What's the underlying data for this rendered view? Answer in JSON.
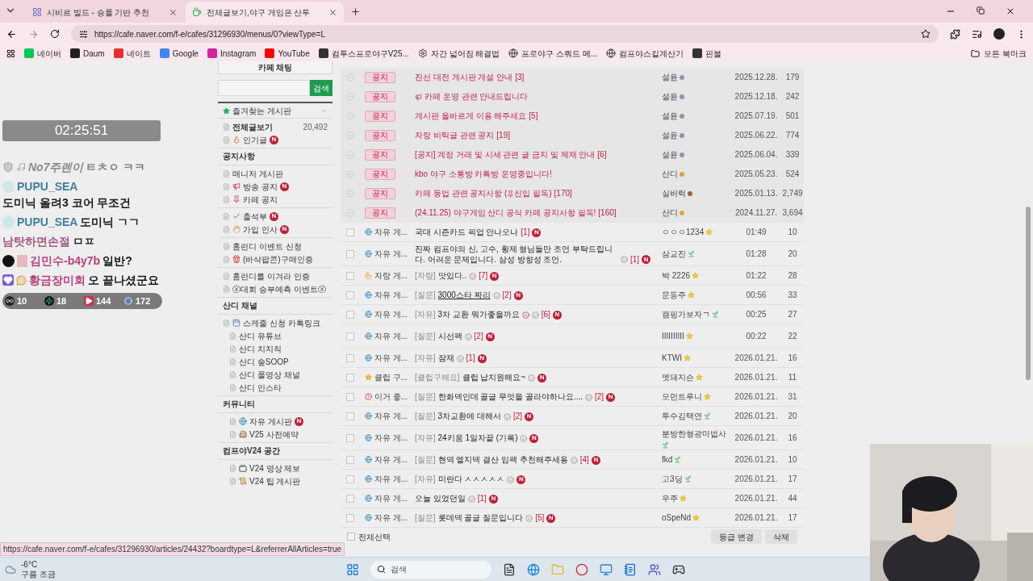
{
  "browser": {
    "tabs": [
      {
        "title": "시비르 빌드 - 승률 기반 추천",
        "kind": "app",
        "selected": false
      },
      {
        "title": "전체글보기,야구 게임은 산투",
        "kind": "cafe",
        "selected": true
      }
    ],
    "url": "https://cafe.naver.com/f-e/cafes/31296930/menus/0?viewType=L",
    "bookmarks": [
      {
        "label": "네이버",
        "kind": "naver"
      },
      {
        "label": "Daum",
        "kind": "daum"
      },
      {
        "label": "네이트",
        "kind": "nate"
      },
      {
        "label": "Google",
        "kind": "google"
      },
      {
        "label": "Instagram",
        "kind": "instagram"
      },
      {
        "label": "YouTube",
        "kind": "youtube"
      },
      {
        "label": "컴투스프로야구V25..."
      },
      {
        "label": "자간 넓어짐 해결법",
        "kind": "gear"
      },
      {
        "label": "프로야구 스쿼드 메...",
        "kind": "globe"
      },
      {
        "label": "컴프야스킬계산기",
        "kind": "globe"
      },
      {
        "label": "핀볼"
      }
    ],
    "all_bookmarks": "모든 북마크"
  },
  "stream": {
    "timer": "02:25:51",
    "chat": [
      {
        "badges": [
          {
            "kind": "shield"
          },
          {
            "kind": "note"
          }
        ],
        "nick": "No7주렌이",
        "text": "ㅌㅊㅇ ㅋㅋ",
        "color": "#8a8a8a",
        "faded": true
      },
      {
        "badges": [
          {
            "kind": "half"
          }
        ],
        "nick": "PUPU_SEA",
        "text": "도미닉 올려3 코어 무조건",
        "color": "#3f7fa0",
        "faded": false
      },
      {
        "badges": [
          {
            "kind": "half"
          }
        ],
        "nick": "PUPU_SEA",
        "text": "도미닉 ㄱㄱ",
        "color": "#3f7fa0",
        "faded": false
      },
      {
        "nick": "남탓하면손절",
        "text": "ㅁㅍ",
        "color": "#a05a80",
        "faded": false
      },
      {
        "badges": [
          {
            "kind": "dot"
          },
          {
            "kind": "box"
          }
        ],
        "nick": "김민수-b4y7b",
        "text": "일반?",
        "color": "#b8407a",
        "faded": false
      },
      {
        "badges": [
          {
            "kind": "heart"
          },
          {
            "kind": "bubble"
          }
        ],
        "nick": "황금장미회",
        "text": "오 끝나셨군요",
        "color": "#b8407a",
        "faded": false
      }
    ],
    "stats": [
      {
        "kind": "infinity",
        "count": "10"
      },
      {
        "kind": "bolt",
        "count": "18"
      },
      {
        "kind": "play",
        "count": "144"
      },
      {
        "kind": "circle",
        "count": "172"
      }
    ]
  },
  "sidebar": {
    "chat_button": "카페 채팅",
    "search_button": "검색",
    "favorites": "즐겨찾는 게시판",
    "sections": [
      {
        "items": [
          {
            "label": "전체글보기",
            "count": "20,492",
            "bold": true,
            "kind": "plain"
          },
          {
            "label": "인기글",
            "badge": "N",
            "bold": false,
            "kind": "flame"
          }
        ]
      },
      {
        "title": "공지사항",
        "items": [
          {
            "label": "매니저 게시판",
            "bold": false,
            "kind": "plain"
          },
          {
            "label": "방송 공지",
            "badge": "N",
            "bold": false,
            "kind": "megaphone"
          },
          {
            "label": "카페 공지",
            "bold": false,
            "kind": "pin"
          }
        ]
      },
      {
        "items": [
          {
            "label": "출석부",
            "badge": "N",
            "bold": false,
            "kind": "check"
          },
          {
            "label": "가입 인사",
            "badge": "N",
            "bold": false,
            "kind": "hand"
          }
        ]
      },
      {
        "items": [
          {
            "label": "홈런디 이벤트 신청",
            "bold": false,
            "kind": "plain"
          },
          {
            "label": "(바삭팝콘)구매인증",
            "bold": false,
            "kind": "popcorn"
          }
        ]
      },
      {
        "items": [
          {
            "label": "홈런디를 이겨라 인증",
            "bold": false,
            "kind": "plain"
          },
          {
            "label": "ⓧ대회 승부예측 이벤트ⓧ",
            "bold": false,
            "kind": "plain"
          }
        ]
      },
      {
        "title": "산디 채널",
        "items": [
          {
            "label": "스케줄 신청 카톡링크",
            "bold": false,
            "kind": "calendar"
          }
        ],
        "subitems": [
          {
            "label": "산디 유튜브",
            "kind": "plain"
          },
          {
            "label": "산디 치지직",
            "kind": "plain"
          },
          {
            "label": "산디 숲SOOP",
            "kind": "plain"
          },
          {
            "label": "산디 풀영상 채널",
            "kind": "plain"
          },
          {
            "label": "산디 인스타",
            "kind": "plain"
          }
        ]
      },
      {
        "title": "커뮤니티",
        "subitems": [
          {
            "label": "자유 게시판",
            "badge": "N",
            "kind": "globe"
          },
          {
            "label": "V25 사전예약",
            "kind": "building"
          }
        ]
      },
      {
        "title": "컴프야V24 공간",
        "subitems": [
          {
            "label": "V24 영상 제보",
            "kind": "tv"
          },
          {
            "label": "V24 팁 게시판",
            "kind": "scroll"
          }
        ]
      }
    ]
  },
  "board": {
    "rows": [
      {
        "kind": "notice",
        "tag": "공지",
        "title": "진선 대전 게시판 개설 안내",
        "comments": "[3]",
        "author": "설윤",
        "rank": {
          "kind": "dot",
          "color": "#8a96b0"
        },
        "date": "2025.12.28.",
        "views": "179"
      },
      {
        "kind": "notice",
        "tag": "공지",
        "lead": {
          "kind": "megaphone"
        },
        "title": "카페 운영 관련 안내드립니다",
        "author": "설윤",
        "rank": {
          "kind": "dot",
          "color": "#8a96b0"
        },
        "date": "2025.12.18.",
        "views": "242"
      },
      {
        "kind": "notice",
        "tag": "공지",
        "title": "게시판 올바르게 이용 해주세요",
        "comments": "[5]",
        "author": "설윤",
        "rank": {
          "kind": "dot",
          "color": "#8a96b0"
        },
        "date": "2025.07.19.",
        "views": "501"
      },
      {
        "kind": "notice",
        "tag": "공지",
        "title": "자랑 비틱글 관련 공지",
        "comments": "[19]",
        "author": "설윤",
        "rank": {
          "kind": "dot",
          "color": "#8a96b0"
        },
        "date": "2025.06.22.",
        "views": "774"
      },
      {
        "kind": "notice",
        "tag": "공지",
        "title": "[공지] 계정 거래 및 시세 관련 글 금지 및 제재 안내",
        "comments": "[6]",
        "author": "설윤",
        "rank": {
          "kind": "dot",
          "color": "#8a96b0"
        },
        "date": "2025.06.04.",
        "views": "339"
      },
      {
        "kind": "notice",
        "tag": "공지",
        "title": "kbo 야구 소통방 카톡방 운영중입니다!",
        "author": "산디",
        "rank": {
          "kind": "dot",
          "color": "#e0a63a"
        },
        "date": "2025.05.23.",
        "views": "524"
      },
      {
        "kind": "notice",
        "tag": "공지",
        "title": "카페 등업 관련 공지사항 (",
        "inline": {
          "kind": "pin"
        },
        "title_rest": "신입 필독)",
        "comments": "[170]",
        "author": "실버럭",
        "rank": {
          "kind": "dot",
          "color": "#a0603a"
        },
        "date": "2025.01.13.",
        "views": "2,749"
      },
      {
        "kind": "notice",
        "tag": "공지",
        "title": "(24.11.25) 야구게임 산디 공식 카페 공지사항 필독!",
        "comments": "[160]",
        "author": "산디",
        "rank": {
          "kind": "dot",
          "color": "#e0a63a"
        },
        "date": "2024.11.27.",
        "views": "3,694"
      },
      {
        "kind": "post",
        "checked": false,
        "board": {
          "label": "자유 게...",
          "kind": "globe"
        },
        "title": "국대 시즌카드 픽업 안나오나",
        "comments": "[1]",
        "badge": "N",
        "author": "ㅇㅇㅇ1234",
        "rank": {
          "kind": "star"
        },
        "date": "01:49",
        "views": "10"
      },
      {
        "kind": "post",
        "checked": false,
        "board": {
          "label": "자유 게...",
          "kind": "globe"
        },
        "title": "진짜 컴프야의 신, 고수, 황제 형님들만 조언 부탁드립니다. 어려운 문제입니다. 삼성 방향성 조언.",
        "image": true,
        "comments": "[1]",
        "badge": "N",
        "author": "삼교진",
        "rank": {
          "kind": "sprout"
        },
        "date": "01:28",
        "views": "20"
      },
      {
        "kind": "post",
        "checked": false,
        "board": {
          "label": "자랑 게...",
          "kind": "arm"
        },
        "prefix": "[자랑]",
        "title": "맛있다..",
        "image": true,
        "comments": "[7]",
        "badge": "N",
        "author": "박 2226",
        "rank": {
          "kind": "star"
        },
        "date": "01:22",
        "views": "28"
      },
      {
        "kind": "post",
        "checked": false,
        "board": {
          "label": "자유 게...",
          "kind": "globe"
        },
        "prefix": "[질문]",
        "title": "3000스타 짜리",
        "hovered": true,
        "image": true,
        "comments": "[2]",
        "badge": "N",
        "author": "문동주",
        "rank": {
          "kind": "star"
        },
        "date": "00:56",
        "views": "33"
      },
      {
        "kind": "post",
        "checked": false,
        "board": {
          "label": "자유 게...",
          "kind": "globe"
        },
        "prefix": "[자유]",
        "title": "3차 교환 뭐가좋을까요",
        "crying": true,
        "image": true,
        "comments": "[6]",
        "badge": "N",
        "author": "캠핑가보자ㄱ",
        "rank": {
          "kind": "sprout"
        },
        "date": "00:25",
        "views": "27"
      },
      {
        "kind": "post",
        "checked": false,
        "board": {
          "label": "자유 게...",
          "kind": "globe"
        },
        "prefix": "[질문]",
        "title": "시선팩",
        "image": true,
        "comments": "[2]",
        "badge": "N",
        "author": "IIIIIIIIII",
        "rank": {
          "kind": "star"
        },
        "date": "00:22",
        "views": "22"
      },
      {
        "kind": "post",
        "checked": false,
        "board": {
          "label": "자유 게...",
          "kind": "globe"
        },
        "prefix": "[자유]",
        "title": "잠재",
        "image": true,
        "comments": "[1]",
        "badge": "N",
        "author": "KTWI",
        "rank": {
          "kind": "star"
        },
        "date": "2026.01.21.",
        "views": "16"
      },
      {
        "kind": "post",
        "checked": false,
        "board": {
          "label": "클럽 구...",
          "kind": "star"
        },
        "prefix": "[클럽구해요]",
        "title": "클럽 납치원해요~",
        "image": true,
        "badge": "N",
        "author": "멧돼지슨",
        "rank": {
          "kind": "star"
        },
        "date": "2026.01.21.",
        "views": "11"
      },
      {
        "kind": "post",
        "checked": false,
        "board": {
          "label": "이거 좋...",
          "kind": "question"
        },
        "prefix": "[질문]",
        "title": "한화덱인데 골글 무엇을 골라야하나요....",
        "image": true,
        "comments": "[2]",
        "badge": "N",
        "author": "모먼트루니",
        "rank": {
          "kind": "star"
        },
        "date": "2026.01.21.",
        "views": "31"
      },
      {
        "kind": "post",
        "checked": false,
        "board": {
          "label": "자유 게...",
          "kind": "globe"
        },
        "prefix": "[질문]",
        "title": "3차교환에 대해서",
        "image": true,
        "comments": "[2]",
        "badge": "N",
        "author": "투수김택연",
        "rank": {
          "kind": "sprout"
        },
        "date": "2026.01.21.",
        "views": "20"
      },
      {
        "kind": "post",
        "checked": false,
        "board": {
          "label": "자유 게...",
          "kind": "globe"
        },
        "prefix": "[자유]",
        "title": "24키움 1일차끝 (기록)",
        "image": true,
        "badge": "N",
        "author": "분방한형광마법사",
        "rank": {
          "kind": "sprout"
        },
        "date": "2026.01.21.",
        "views": "16"
      },
      {
        "kind": "post",
        "checked": false,
        "board": {
          "label": "자유 게...",
          "kind": "globe"
        },
        "prefix": "[질문]",
        "title": "현역 엘지덱 결산 임팩 추천해주세용",
        "image": true,
        "comments": "[4]",
        "badge": "N",
        "author": "fkd",
        "rank": {
          "kind": "sprout"
        },
        "date": "2026.01.21.",
        "views": "10"
      },
      {
        "kind": "post",
        "checked": false,
        "board": {
          "label": "자유 게...",
          "kind": "globe"
        },
        "prefix": "[자유]",
        "title": "미란다 ㅅㅅㅅㅅㅅ",
        "image": true,
        "badge": "N",
        "author": "고3딩",
        "rank": {
          "kind": "sprout"
        },
        "date": "2026.01.21.",
        "views": "17"
      },
      {
        "kind": "post",
        "checked": false,
        "board": {
          "label": "자유 게...",
          "kind": "globe"
        },
        "title": "오늘 있었던일",
        "image": true,
        "comments": "[1]",
        "badge": "N",
        "author": "우주",
        "rank": {
          "kind": "star"
        },
        "date": "2026.01.21.",
        "views": "44"
      },
      {
        "kind": "post",
        "checked": false,
        "board": {
          "label": "자유 게...",
          "kind": "globe"
        },
        "prefix": "[질문]",
        "title": "롯데덱 골글 질문입니다",
        "image": true,
        "comments": "[5]",
        "badge": "N",
        "author": "oSpeNd",
        "rank": {
          "kind": "star"
        },
        "date": "2026.01.21.",
        "views": "17"
      }
    ],
    "select_all": {
      "label": "전체선택",
      "checked": false
    },
    "buttons": [
      "등급 변경",
      "삭제"
    ]
  },
  "status_url": "https://cafe.naver.com/f-e/cafes/31296930/articles/24432?boardtype=L&referrerAllArticles=true",
  "taskbar": {
    "temperature": "-6°C",
    "weather": "구름 조금",
    "search": "검색",
    "apps": [
      {
        "kind": "files"
      },
      {
        "kind": "browser"
      },
      {
        "kind": "folder"
      },
      {
        "kind": "chrome"
      },
      {
        "kind": "monitor"
      },
      {
        "kind": "notes"
      },
      {
        "kind": "team"
      },
      {
        "kind": "game"
      }
    ]
  }
}
